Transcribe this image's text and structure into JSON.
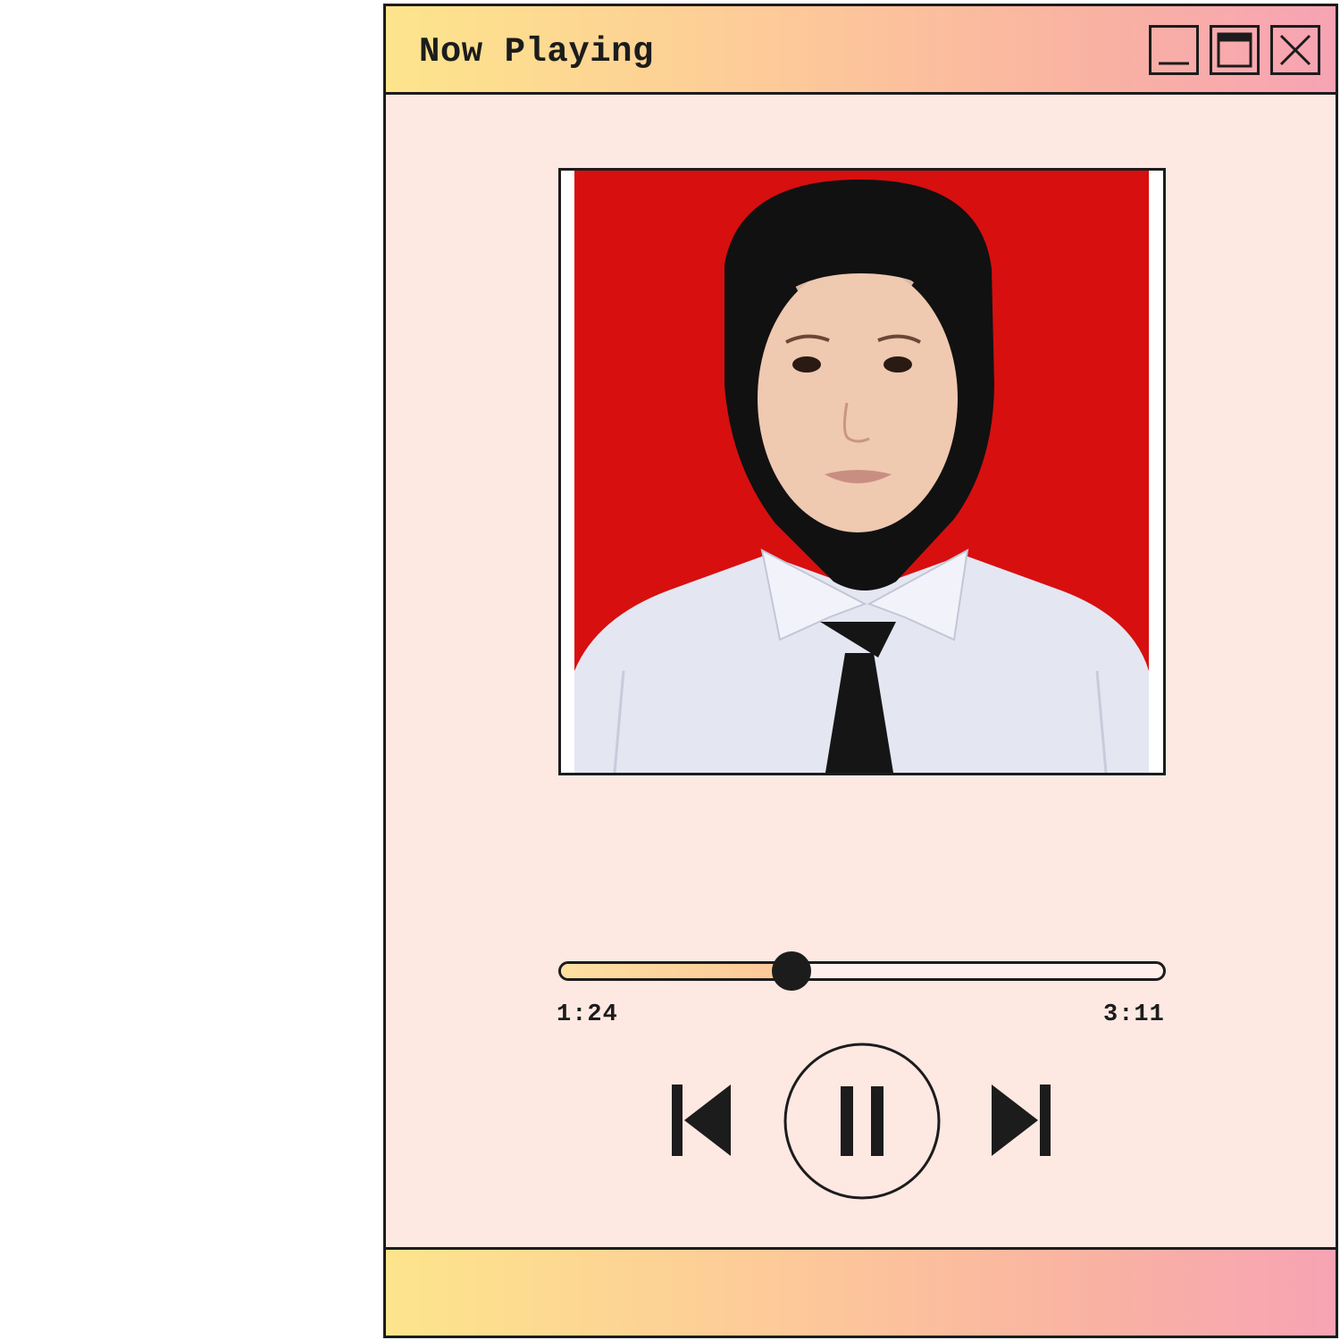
{
  "window": {
    "title": "Now Playing",
    "controls": {
      "minimize_icon": "minimize-icon",
      "maximize_icon": "maximize-icon",
      "close_icon": "close-icon"
    }
  },
  "album_art": {
    "icon": "portrait-photo",
    "colors": {
      "background": "#d70f0f",
      "hijab": "#111111",
      "shirt": "#e4e6f2",
      "tie": "#151515"
    }
  },
  "player": {
    "elapsed": "1:24",
    "total": "3:11",
    "progress_fraction": 0.384,
    "buttons": {
      "previous_icon": "skip-previous-icon",
      "pause_icon": "pause-icon",
      "next_icon": "skip-next-icon"
    }
  },
  "colors": {
    "window_bg": "#fde8e2",
    "gradient_start": "#fde58c",
    "gradient_end": "#f7a3b4",
    "progress_fill": "#fcc79a",
    "ink": "#1c1c1c"
  }
}
